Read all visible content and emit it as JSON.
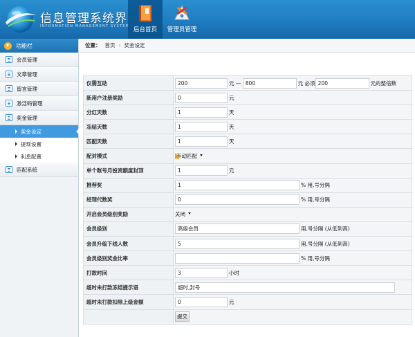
{
  "app": {
    "title": "信息管理系统界面",
    "subtitle": "INFORMATION MANAGEMENT SYSTEM GUI"
  },
  "topnav": [
    {
      "label": "后台首页",
      "icon": "book-icon",
      "active": true
    },
    {
      "label": "管理员管理",
      "icon": "admin-tools-icon",
      "active": false
    }
  ],
  "sidebar": {
    "header": "功能栏",
    "items": [
      {
        "label": "会员管理"
      },
      {
        "label": "文章管理"
      },
      {
        "label": "留言管理"
      },
      {
        "label": "激活码管理"
      },
      {
        "label": "奖金管理",
        "children": [
          {
            "label": "奖金设定",
            "active": true
          },
          {
            "label": "提现设置",
            "active": false
          },
          {
            "label": "利息配置",
            "active": false
          }
        ]
      },
      {
        "label": "匹配系统"
      }
    ]
  },
  "breadcrumb": {
    "prefix": "位置：",
    "items": [
      "首页",
      "奖金设定"
    ],
    "separator": "›"
  },
  "form": {
    "rows": [
      {
        "label": "仅需互助",
        "min": "200",
        "unit1": "元 —",
        "max": "800",
        "unit2": "元 必须",
        "multiple": "200",
        "suffix": "元的整倍数"
      },
      {
        "label": "新用户注册奖励",
        "value": "0",
        "suffix": "元"
      },
      {
        "label": "分红天数",
        "value": "1",
        "suffix": "天"
      },
      {
        "label": "冻结天数",
        "value": "1",
        "suffix": "天"
      },
      {
        "label": "匹配天数",
        "value": "1",
        "suffix": "天"
      },
      {
        "label": "配对模式",
        "value": "手动匹配"
      },
      {
        "label": "单个账号月投资额度封顶",
        "value": "1",
        "suffix": "元"
      },
      {
        "label": "推荐奖",
        "value": "1",
        "suffix": "% 用,号分隔"
      },
      {
        "label": "经理代数奖",
        "value": "0",
        "suffix": "% 用,号分隔"
      },
      {
        "label": "开启会员级别奖励",
        "value": "关闭"
      },
      {
        "label": "会员级别",
        "value": "高级会员",
        "suffix": "用,号分隔 (从低到高)"
      },
      {
        "label": "会员升级下线人数",
        "value": "5",
        "suffix": "用,号分隔 (从低到高)"
      },
      {
        "label": "会员级别奖金比率",
        "value": "",
        "suffix": "% 用,号分隔"
      },
      {
        "label": "打款时间",
        "value": "3",
        "suffix": "小时"
      },
      {
        "label": "超时未打款冻结提示语",
        "value": "超时,封号"
      },
      {
        "label": "超时未打款扣除上级金额",
        "value": "0",
        "suffix": "元"
      }
    ],
    "submit_label": "提交"
  },
  "colors": {
    "header_blue": "#1f7dc0",
    "active_tab": "#0d5c98",
    "sidebar_active": "#3f9ae0",
    "accent_orange": "#f7b325"
  }
}
